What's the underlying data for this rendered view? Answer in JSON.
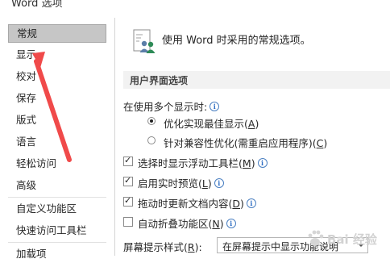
{
  "window": {
    "title": "Word 选项"
  },
  "sidebar": {
    "items": [
      {
        "label": "常规"
      },
      {
        "label": "显示"
      },
      {
        "label": "校对"
      },
      {
        "label": "保存"
      },
      {
        "label": "版式"
      },
      {
        "label": "语言"
      },
      {
        "label": "轻松访问"
      },
      {
        "label": "高级"
      },
      {
        "label": "自定义功能区"
      },
      {
        "label": "快速访问工具栏"
      },
      {
        "label": "加载项"
      }
    ],
    "selected": "常规"
  },
  "main": {
    "header_text": "使用 Word 时采用的常规选项。",
    "section_title": "用户界面选项",
    "multi_display_label": "在使用多个显示时:",
    "radio_optimize_best": {
      "text": "优化实现最佳显示(",
      "key": "A",
      "tail": ")",
      "checked": true
    },
    "radio_optimize_compat": {
      "text": "针对兼容性优化(需重启应用程序)(",
      "key": "C",
      "tail": ")",
      "checked": false
    },
    "cb_mini_toolbar": {
      "text": "选择时显示浮动工具栏(",
      "key": "M",
      "tail": ")",
      "checked": true
    },
    "cb_live_preview": {
      "text": "启用实时预览(",
      "key": "L",
      "tail": ")",
      "checked": true
    },
    "cb_update_drag": {
      "text": "拖动时更新文档内容(",
      "key": "D",
      "tail": ")",
      "checked": true
    },
    "cb_collapse_ribbon": {
      "text": "自动折叠功能区(",
      "key": "N",
      "tail": ")",
      "checked": false
    },
    "screentip_label": {
      "text": "屏幕提示样式(",
      "key": "R",
      "tail": "):"
    },
    "screentip_value": "在屏幕提示中显示功能说明"
  },
  "watermark": {
    "text": "Bai 经验"
  },
  "colors": {
    "annotation_arrow": "#f04a4a",
    "selected_item_bg": "#c6c6c6",
    "section_bg": "#f2f2f2"
  },
  "icons": {
    "header": "options-people-icon",
    "info": "info-icon",
    "dropdown": "chevron-down-icon"
  }
}
